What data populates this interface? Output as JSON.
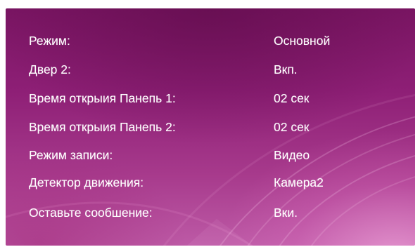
{
  "settings": {
    "rows": [
      {
        "label": "Режим:",
        "value": "Основной"
      },
      {
        "label": "Двер   2:",
        "value": "Вкп."
      },
      {
        "label": "Время открыия Панепь 1:",
        "value": "02 сек"
      },
      {
        "label": "Время открыия Панепь 2:",
        "value": "02 сек"
      },
      {
        "label": "Режим записи:",
        "value": "Видео"
      },
      {
        "label": "Детектор движения:",
        "value": "Камера2"
      },
      {
        "label": "Оставьте сообшение:",
        "value": "Вки."
      }
    ]
  },
  "theme": {
    "background_top": "#7a1563",
    "background_bottom": "#bd5aa6",
    "text_color": "#ffffff"
  }
}
